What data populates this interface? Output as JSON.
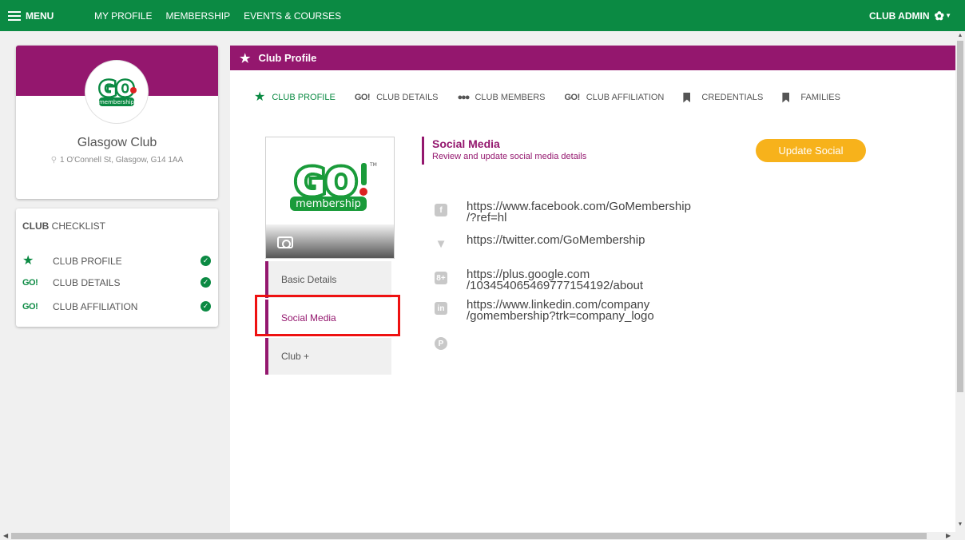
{
  "topbar": {
    "menu_label": "MENU",
    "links": [
      "MY PROFILE",
      "MEMBERSHIP",
      "EVENTS & COURSES"
    ],
    "admin_label": "CLUB ADMIN"
  },
  "club": {
    "name": "Glasgow Club",
    "address": "1 O'Connell St, Glasgow, G14 1AA",
    "logo_word": "GO!",
    "logo_sub": "membership",
    "logo_tm": "TM"
  },
  "checklist": {
    "title_bold": "CLUB",
    "title_rest": " CHECKLIST",
    "items": [
      {
        "icon": "star",
        "label": "CLUB PROFILE",
        "done": true
      },
      {
        "icon": "go",
        "label": "CLUB DETAILS",
        "done": true
      },
      {
        "icon": "go",
        "label": "CLUB AFFILIATION",
        "done": true
      }
    ],
    "go_text": "GO!"
  },
  "main": {
    "header_title": "Club Profile",
    "tabs": [
      {
        "icon": "star",
        "label": "CLUB PROFILE"
      },
      {
        "icon": "go",
        "label": "CLUB DETAILS"
      },
      {
        "icon": "people",
        "label": "CLUB MEMBERS"
      },
      {
        "icon": "go",
        "label": "CLUB AFFILIATION"
      },
      {
        "icon": "bookmark",
        "label": "CREDENTIALS"
      },
      {
        "icon": "bookmark",
        "label": "FAMILIES"
      }
    ],
    "side_menu": [
      "Basic Details",
      "Social Media",
      "Club +"
    ],
    "section_title": "Social Media",
    "section_subtitle": "Review and update social media details",
    "update_button": "Update Social",
    "social": [
      {
        "icon": "facebook-icon",
        "glyph": "f",
        "url": "https://www.facebook.com/GoMembership\n/?ref=hl"
      },
      {
        "icon": "twitter-icon",
        "glyph": "🐦",
        "url": "https://twitter.com/GoMembership"
      },
      {
        "icon": "google-plus-icon",
        "glyph": "8+",
        "url": "https://plus.google.com\n/103454065469777154192/about"
      },
      {
        "icon": "linkedin-icon",
        "glyph": "in",
        "url": "https://www.linkedin.com/company\n/gomembership?trk=company_logo"
      },
      {
        "icon": "pinterest-icon",
        "glyph": "P",
        "url": ""
      }
    ]
  },
  "colors": {
    "green": "#0b8a43",
    "purple": "#94176e",
    "orange": "#f7b21b",
    "highlight": "#ee1111"
  }
}
